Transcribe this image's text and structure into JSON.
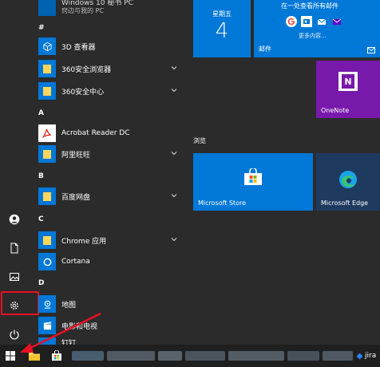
{
  "apps": {
    "top_partial": "Windows 10 秘书 PC",
    "top_partial2": "窍边与我的 PC",
    "letter_hash": "#",
    "letter_a": "A",
    "letter_b": "B",
    "letter_c": "C",
    "letter_d": "D",
    "item_3d": "3D 查看器",
    "item_360browser": "360安全浏览器",
    "item_360center": "360安全中心",
    "item_acrobat": "Acrobat Reader DC",
    "item_aliww": "阿里旺旺",
    "item_baidu": "百度网盘",
    "item_chrome": "Chrome 应用",
    "item_cortana": "Cortana",
    "item_maps": "地图",
    "item_movies": "电影和电视",
    "item_partial_bottom": "钉钉"
  },
  "tiles": {
    "calendar_day": "星期五",
    "calendar_date": "4",
    "mail_heading": "在一处查看所有邮件",
    "mail_more": "更多内容...",
    "mail_label": "邮件",
    "onenote_label": "OneNote",
    "section_browse": "浏览",
    "store_label": "Microsoft Store",
    "edge_label": "Microsoft Edge"
  },
  "taskbar": {
    "jira_partial": "jira"
  },
  "colors": {
    "tile_blue": "#0078d7",
    "onenote_purple": "#7719aa",
    "edge_navy": "#1f3a5f",
    "highlight_red": "#e81123",
    "folder_yellow": "#ffd65c",
    "background": "#2b2b2b"
  }
}
